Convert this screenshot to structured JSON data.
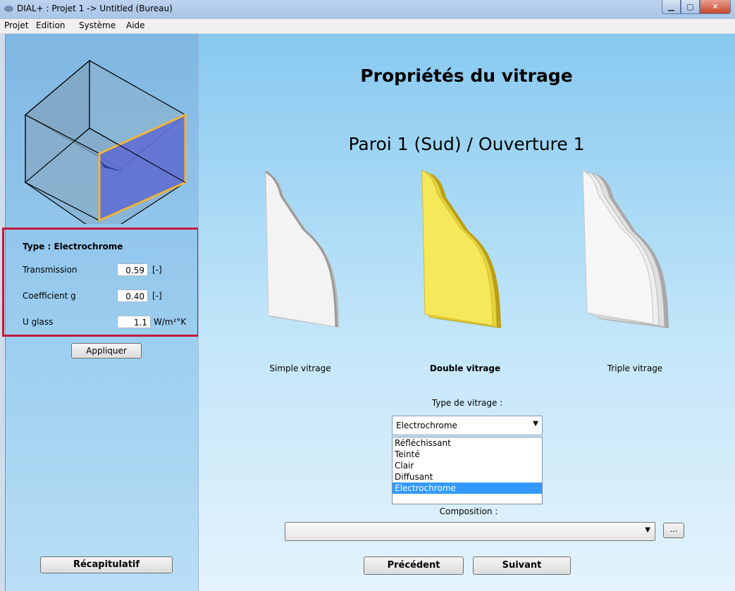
{
  "window": {
    "title": "DIAL+ : Projet 1 -> Untitled (Bureau)"
  },
  "menu": [
    "Projet",
    "Edition",
    "Système",
    "Aide"
  ],
  "left": {
    "type_label": "Type : Electrochrome",
    "fields": [
      {
        "label": "Transmission",
        "value": "0.59",
        "unit": "[-]"
      },
      {
        "label": "Coefficient g",
        "value": "0.40",
        "unit": "[-]"
      },
      {
        "label": "U glass",
        "value": "1.1",
        "unit": "W/m²°K"
      }
    ],
    "apply_button": "Appliquer",
    "summary_button": "Récapitulatif"
  },
  "main": {
    "title": "Propriétés du vitrage",
    "subtitle": "Paroi 1 (Sud) / Ouverture 1",
    "glazing_options": [
      {
        "label": "Simple vitrage"
      },
      {
        "label": "Double vitrage"
      },
      {
        "label": "Triple vitrage"
      }
    ],
    "type_label": "Type de vitrage :",
    "type_selected": "Electrochrome",
    "type_options": [
      "Réfléchissant",
      "Teinté",
      "Clair",
      "Diffusant",
      "Electrochrome"
    ],
    "composition_label": "Composition :",
    "composition_value": "",
    "browse_button": "...",
    "prev_button": "Précédent",
    "next_button": "Suivant"
  },
  "colors": {
    "highlight": "#c3183a",
    "selected_glass": "#f2e44f",
    "selection": "#3399ff"
  }
}
